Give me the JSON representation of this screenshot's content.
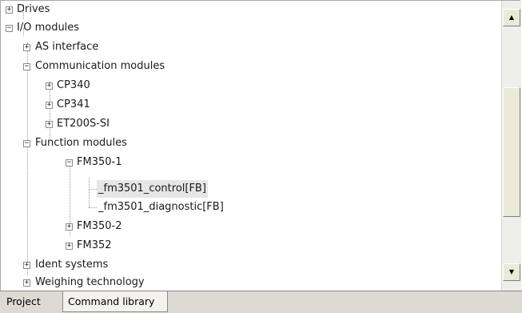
{
  "tree": {
    "items": [
      {
        "label": "Drives",
        "expander": "+"
      },
      {
        "label": "I/O modules",
        "expander": "−"
      },
      {
        "label": "AS interface",
        "expander": "+"
      },
      {
        "label": "Communication modules",
        "expander": "−"
      },
      {
        "label": "CP340",
        "expander": "+"
      },
      {
        "label": "CP341",
        "expander": "+"
      },
      {
        "label": "ET200S-SI",
        "expander": "+"
      },
      {
        "label": "Function modules",
        "expander": "−"
      },
      {
        "label": "FM350-1",
        "expander": "−"
      },
      {
        "label": "_fm3501_control[FB]",
        "expander": ""
      },
      {
        "label": "_fm3501_diagnostic[FB]",
        "expander": ""
      },
      {
        "label": "FM350-2",
        "expander": "+"
      },
      {
        "label": "FM352",
        "expander": "+"
      },
      {
        "label": "Ident systems",
        "expander": "+"
      },
      {
        "label": "Weighing technology",
        "expander": "+"
      }
    ],
    "selected": "_fm3501_control[FB]"
  },
  "scrollbar": {
    "up_arrow": "▲",
    "down_arrow": "▼"
  },
  "tabs": [
    {
      "label": "Project"
    },
    {
      "label": "Command library"
    }
  ]
}
